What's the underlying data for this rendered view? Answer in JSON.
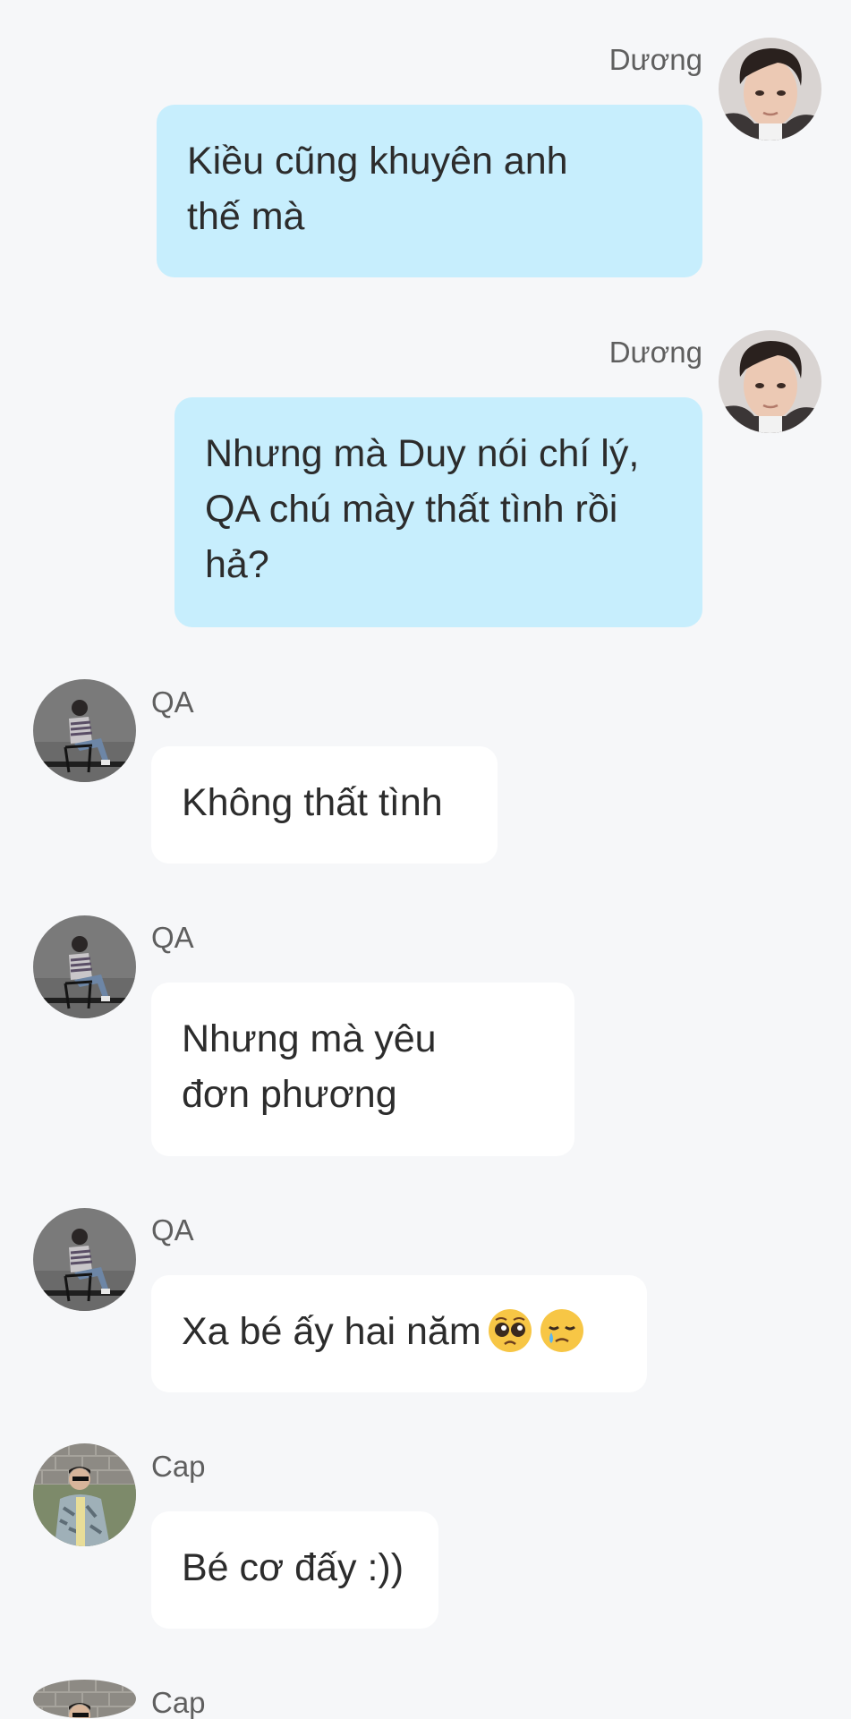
{
  "messages": [
    {
      "sender": "Dương",
      "direction": "outgoing",
      "avatar": "avatar-duong",
      "lines": [
        "Kiều cũng khuyên anh",
        "thế mà"
      ]
    },
    {
      "sender": "Dương",
      "direction": "outgoing",
      "avatar": "avatar-duong",
      "lines": [
        "Nhưng mà Duy nói chí lý,",
        "QA chú mày thất tình rồi",
        "hả?"
      ]
    },
    {
      "sender": "QA",
      "direction": "incoming",
      "avatar": "avatar-qa",
      "lines": [
        "Không thất tình"
      ]
    },
    {
      "sender": "QA",
      "direction": "incoming",
      "avatar": "avatar-qa",
      "lines": [
        "Nhưng mà yêu",
        "đơn phương"
      ]
    },
    {
      "sender": "QA",
      "direction": "incoming",
      "avatar": "avatar-qa",
      "lines": [
        "Xa bé ấy hai năm"
      ],
      "emojis": [
        "pleading-face-emoji",
        "sad-tear-face-emoji"
      ]
    },
    {
      "sender": "Cap",
      "direction": "incoming",
      "avatar": "avatar-cap",
      "lines": [
        "Bé cơ đấy :))"
      ]
    },
    {
      "sender": "Cap",
      "direction": "incoming",
      "avatar": "avatar-cap",
      "lines": []
    }
  ],
  "colors": {
    "background": "#f6f7f9",
    "outgoing_bubble": "#c7eefd",
    "incoming_bubble": "#ffffff",
    "sender_name": "#5f5f5f",
    "message_text": "#2c2c2c"
  }
}
